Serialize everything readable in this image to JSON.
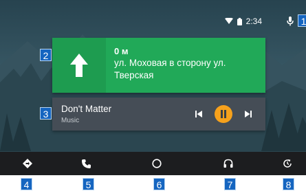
{
  "status_bar": {
    "time": "2:34",
    "icons": [
      "wifi-icon",
      "battery-icon",
      "microphone-icon"
    ]
  },
  "navigation_card": {
    "distance": "0 м",
    "street": "ул. Моховая в сторону ул. Тверская",
    "maneuver_icon": "arrow-straight-icon"
  },
  "media_card": {
    "title": "Don't Matter",
    "source": "Music",
    "controls": [
      "skip-previous-icon",
      "pause-icon",
      "skip-next-icon"
    ]
  },
  "dock": {
    "items": [
      "navigation-icon",
      "phone-icon",
      "home-icon",
      "headphones-icon",
      "recent-icon"
    ]
  },
  "annotations": {
    "labels": [
      "1",
      "2",
      "3",
      "4",
      "5",
      "6",
      "7",
      "8"
    ]
  },
  "colors": {
    "nav_green": "#21a958",
    "media_gray": "#454d56",
    "play_orange": "#f6a11c",
    "dock": "#1c1d1f",
    "label_blue": "#1565c0"
  }
}
